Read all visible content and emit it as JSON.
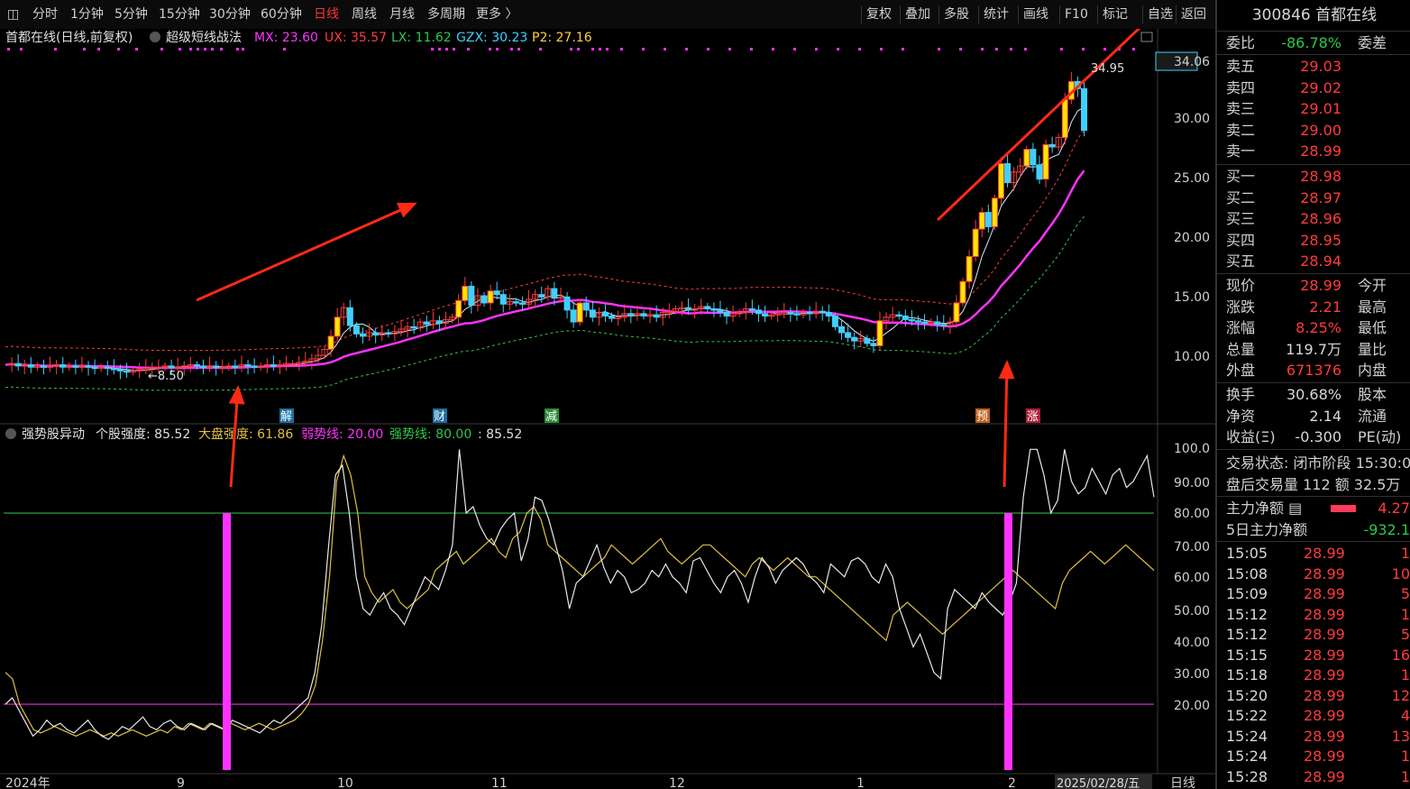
{
  "toolbar": {
    "left_items": [
      "分时",
      "1分钟",
      "5分钟",
      "15分钟",
      "30分钟",
      "60分钟",
      "日线",
      "周线",
      "月线",
      "多周期",
      "更多 〉"
    ],
    "active_item": "日线",
    "right_items": [
      "复权",
      "叠加",
      "多股",
      "统计",
      "画线",
      "F10",
      "标记",
      "自选",
      "返回"
    ]
  },
  "main_chart": {
    "legend_title": "首都在线(日线,前复权)",
    "indicator_name": "超级短线战法",
    "indicators": [
      {
        "text": "MX: 23.60",
        "color": "#ff33ff"
      },
      {
        "text": "UX: 35.57",
        "color": "#ff3c3c"
      },
      {
        "text": "LX: 11.62",
        "color": "#2ec84a"
      },
      {
        "text": "GZX: 30.23",
        "color": "#3fd0ff"
      },
      {
        "text": "P2: 27.16",
        "color": "#ffd23c"
      }
    ],
    "y_axis_labels": [
      "34.06",
      "30.00",
      "25.00",
      "20.00",
      "15.00",
      "10.00"
    ],
    "high_label": "34.95",
    "low_label": "8.50",
    "event_tags": [
      "解",
      "财",
      "减",
      "预",
      "涨"
    ]
  },
  "sub_chart": {
    "title": "强势股异动",
    "values": [
      {
        "text": "个股强度: 85.52",
        "color": "#e0e0e0"
      },
      {
        "text": "大盘强度: 61.86",
        "color": "#e0c040"
      },
      {
        "text": "弱势线: 20.00",
        "color": "#ff33ff"
      },
      {
        "text": "强势线: 80.00",
        "color": "#2ec84a"
      },
      {
        "text": ": 85.52",
        "color": "#e0e0e0"
      }
    ],
    "y_axis_labels": [
      "100.0",
      "90.00",
      "80.00",
      "70.00",
      "60.00",
      "50.00",
      "40.00",
      "30.00",
      "20.00"
    ]
  },
  "x_axis": {
    "labels": [
      "2024年",
      "9",
      "10",
      "11",
      "12",
      "1",
      "2"
    ],
    "cursor_date": "2025/02/28/五",
    "period": "日线"
  },
  "quote_panel": {
    "stock": "300846 首都在线",
    "weibi": {
      "label": "委比",
      "value": "-86.78%",
      "label2": "委差"
    },
    "asks": [
      {
        "label": "卖五",
        "price": "29.03"
      },
      {
        "label": "卖四",
        "price": "29.02"
      },
      {
        "label": "卖三",
        "price": "29.01"
      },
      {
        "label": "卖二",
        "price": "29.00"
      },
      {
        "label": "卖一",
        "price": "28.99"
      }
    ],
    "bids": [
      {
        "label": "买一",
        "price": "28.98"
      },
      {
        "label": "买二",
        "price": "28.97"
      },
      {
        "label": "买三",
        "price": "28.96"
      },
      {
        "label": "买四",
        "price": "28.95"
      },
      {
        "label": "买五",
        "price": "28.94"
      }
    ],
    "stats": [
      {
        "k": "现价",
        "v": "28.99",
        "c": "red",
        "k2": "今开"
      },
      {
        "k": "涨跌",
        "v": "2.21",
        "c": "red",
        "k2": "最高"
      },
      {
        "k": "涨幅",
        "v": "8.25%",
        "c": "red",
        "k2": "最低"
      },
      {
        "k": "总量",
        "v": "119.7万",
        "c": "wht",
        "k2": "量比"
      },
      {
        "k": "外盘",
        "v": "671376",
        "c": "red",
        "k2": "内盘"
      }
    ],
    "stats2": [
      {
        "k": "换手",
        "v": "30.68%",
        "c": "wht",
        "k2": "股本"
      },
      {
        "k": "净资",
        "v": "2.14",
        "c": "wht",
        "k2": "流通"
      },
      {
        "k": "收益(Ξ)",
        "v": "-0.300",
        "c": "wht",
        "k2": "PE(动)"
      }
    ],
    "status": "交易状态: 闭市阶段 15:30:0",
    "after_hours": "盘后交易量 112 额 32.5万",
    "main_flow": {
      "label": "主力净额",
      "value": "4.27"
    },
    "main_flow5": {
      "label": "5日主力净额",
      "value": "-932.1"
    },
    "ticks": [
      {
        "t": "15:05",
        "p": "28.99",
        "v": "1"
      },
      {
        "t": "15:08",
        "p": "28.99",
        "v": "10"
      },
      {
        "t": "15:09",
        "p": "28.99",
        "v": "5"
      },
      {
        "t": "15:12",
        "p": "28.99",
        "v": "1"
      },
      {
        "t": "15:12",
        "p": "28.99",
        "v": "5"
      },
      {
        "t": "15:15",
        "p": "28.99",
        "v": "16"
      },
      {
        "t": "15:18",
        "p": "28.99",
        "v": "1"
      },
      {
        "t": "15:20",
        "p": "28.99",
        "v": "12"
      },
      {
        "t": "15:22",
        "p": "28.99",
        "v": "4"
      },
      {
        "t": "15:24",
        "p": "28.99",
        "v": "13"
      },
      {
        "t": "15:24",
        "p": "28.99",
        "v": "1"
      },
      {
        "t": "15:28",
        "p": "28.99",
        "v": "1"
      }
    ]
  }
}
